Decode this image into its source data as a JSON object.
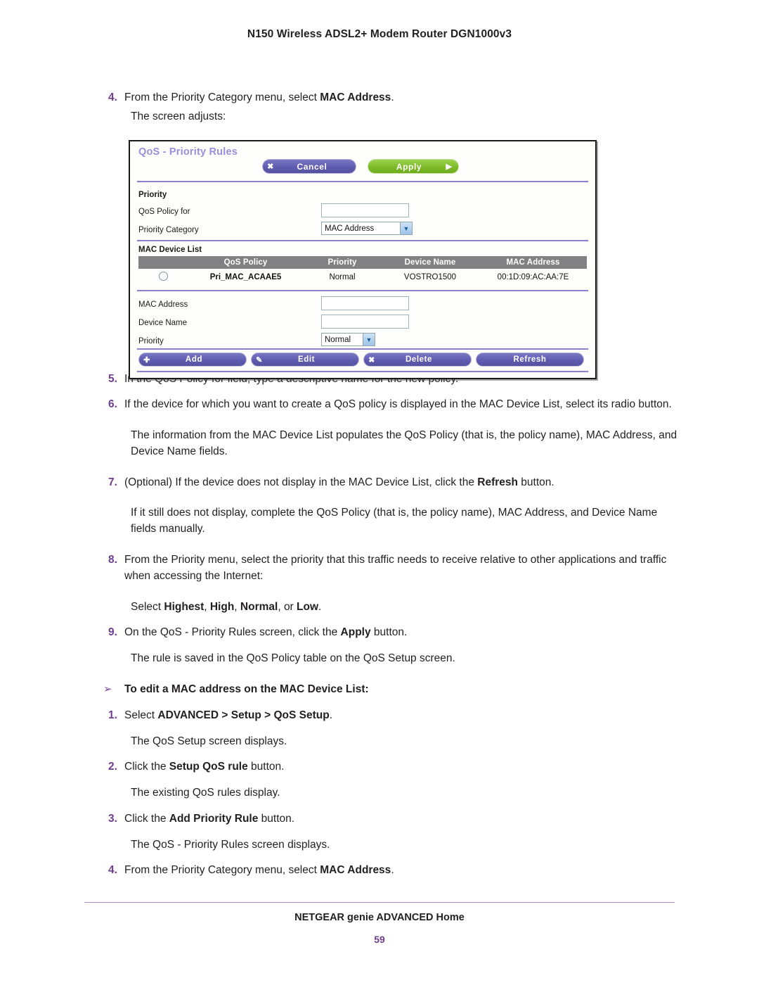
{
  "header": {
    "title": "N150 Wireless ADSL2+ Modem Router DGN1000v3"
  },
  "footer": {
    "title": "NETGEAR genie ADVANCED Home",
    "page_number": "59"
  },
  "colors": {
    "accent_purple": "#6f3d8f",
    "button_purple": "#5f5bb0",
    "button_green": "#7cba28",
    "table_header_gray": "#818184",
    "rule_purple": "#8a7fd0",
    "panel_title_purple": "#9a8fd8"
  },
  "body": {
    "step4_num": "4.",
    "step4_pre": "From the Priority Category menu, select ",
    "step4_bold": "MAC Address",
    "step4_post": ".",
    "step4_result": "The screen adjusts:",
    "step5_num": "5.",
    "step5_text": "In the QoS Policy for field, type a descriptive name for the new policy.",
    "step6_num": "6.",
    "step6_text": "If the device for which you want to create a QoS policy is displayed in the MAC Device List, select its radio button.",
    "step6_result": "The information from the MAC Device List populates the QoS Policy (that is, the policy name), MAC Address, and Device Name fields.",
    "step7_num": "7.",
    "step7_pre": "(Optional) If the device does not display in the MAC Device List, click the ",
    "step7_bold": "Refresh",
    "step7_post": " button.",
    "step7_result": "If it still does not display, complete the QoS Policy (that is, the policy name), MAC Address, and Device Name fields manually.",
    "step8_num": "8.",
    "step8_text": "From the Priority menu, select the priority that this traffic needs to receive relative to other applications and traffic when accessing the Internet:",
    "step8_select_pre": "Select ",
    "step8_opt1": "Highest",
    "step8_sep1": ", ",
    "step8_opt2": "High",
    "step8_sep2": ", ",
    "step8_opt3": "Normal",
    "step8_sep3": ", or ",
    "step8_opt4": "Low",
    "step8_select_post": ".",
    "step9_num": "9.",
    "step9_pre": "On the QoS - Priority Rules screen, click the ",
    "step9_bold": "Apply",
    "step9_post": " button.",
    "step9_result": "The rule is saved in the QoS Policy table on the QoS Setup screen.",
    "arrow_glyph": "➢",
    "procedure_heading": "To edit a MAC address on the MAC Device List:",
    "p1_num": "1.",
    "p1_pre": "Select ",
    "p1_bold": "ADVANCED > Setup > QoS Setup",
    "p1_post": ".",
    "p1_result": "The QoS Setup screen displays.",
    "p2_num": "2.",
    "p2_pre": "Click the ",
    "p2_bold": "Setup QoS rule",
    "p2_post": " button.",
    "p2_result": "The existing QoS rules display.",
    "p3_num": "3.",
    "p3_pre": "Click the ",
    "p3_bold": "Add Priority Rule",
    "p3_post": " button.",
    "p3_result": "The QoS - Priority Rules screen displays.",
    "p4_num": "4.",
    "p4_pre": "From the Priority Category menu, select ",
    "p4_bold": "MAC Address",
    "p4_post": "."
  },
  "screenshot": {
    "panel_title": "QoS - Priority Rules",
    "cancel_button": {
      "label": "Cancel",
      "icon": "close-icon",
      "glyph": "✖"
    },
    "apply_button": {
      "label": "Apply",
      "icon": "arrow-right-icon",
      "glyph": "▶"
    },
    "priority_section_label": "Priority",
    "qos_policy_for_label": "QoS Policy for",
    "qos_policy_for_value": "",
    "priority_category_label": "Priority Category",
    "priority_category_value": "MAC Address",
    "mac_device_list_label": "MAC Device List",
    "table": {
      "columns": [
        "",
        "QoS Policy",
        "Priority",
        "Device Name",
        "MAC Address"
      ],
      "rows": [
        {
          "selected": false,
          "qos_policy": "Pri_MAC_ACAAE5",
          "priority": "Normal",
          "device_name": "VOSTRO1500",
          "mac_address": "00:1D:09:AC:AA:7E"
        }
      ]
    },
    "mac_address_label": "MAC Address",
    "mac_address_value": "",
    "device_name_label": "Device Name",
    "device_name_value": "",
    "priority_label": "Priority",
    "priority_value": "Normal",
    "add_button": {
      "label": "Add",
      "icon": "plus-icon",
      "glyph": "✚"
    },
    "edit_button": {
      "label": "Edit",
      "icon": "pencil-icon",
      "glyph": "✎"
    },
    "delete_button": {
      "label": "Delete",
      "icon": "close-icon",
      "glyph": "✖"
    },
    "refresh_button": {
      "label": "Refresh",
      "icon": "none",
      "glyph": ""
    }
  }
}
